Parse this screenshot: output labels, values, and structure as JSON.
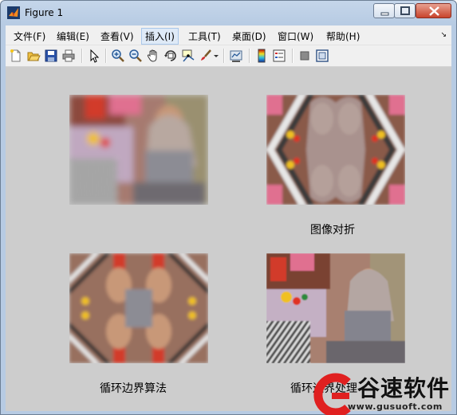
{
  "window": {
    "title": "Figure 1",
    "buttons": [
      "minimize-icon",
      "maximize-icon",
      "close-icon"
    ]
  },
  "menu": {
    "items": [
      {
        "label": "文件(F)"
      },
      {
        "label": "编辑(E)"
      },
      {
        "label": "查看(V)"
      },
      {
        "label": "插入(I)"
      },
      {
        "label": "工具(T)"
      },
      {
        "label": "桌面(D)"
      },
      {
        "label": "窗口(W)"
      },
      {
        "label": "帮助(H)"
      }
    ],
    "active_index": 3
  },
  "toolbar": {
    "icons": [
      "new-figure-icon",
      "open-file-icon",
      "save-icon",
      "print-icon",
      "edit-plot-arrow-icon",
      "zoom-in-icon",
      "zoom-out-icon",
      "pan-hand-icon",
      "rotate-3d-icon",
      "data-cursor-icon",
      "brush-icon",
      "brush-dropdown-icon",
      "link-plot-icon",
      "insert-colorbar-icon",
      "insert-legend-icon",
      "hide-plot-tools-icon",
      "show-plot-tools-icon"
    ]
  },
  "figure": {
    "background": "#cdcdcd",
    "subplots": [
      {
        "caption": ""
      },
      {
        "caption": "图像对折"
      },
      {
        "caption": "循环边界算法"
      },
      {
        "caption": "循环边界处理"
      }
    ]
  },
  "watermark": {
    "brand": "谷速软件",
    "url": "www.gusuoft.com",
    "color": "#e02020"
  }
}
